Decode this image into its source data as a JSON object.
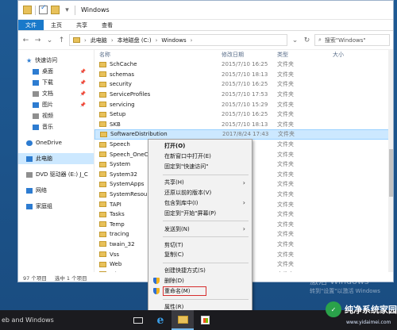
{
  "window": {
    "title": "Windows",
    "ribbon_tabs": [
      "文件",
      "主页",
      "共享",
      "查看"
    ],
    "breadcrumb": [
      "此电脑",
      "本地磁盘 (C:)",
      "Windows"
    ],
    "search_placeholder": "搜索\"Windows\""
  },
  "columns": {
    "name": "名称",
    "date": "修改日期",
    "type": "类型",
    "size": "大小"
  },
  "files": [
    {
      "name": "SchCache",
      "date": "2015/7/10 16:25",
      "type": "文件夹"
    },
    {
      "name": "schemas",
      "date": "2015/7/10 18:13",
      "type": "文件夹"
    },
    {
      "name": "security",
      "date": "2015/7/10 16:25",
      "type": "文件夹"
    },
    {
      "name": "ServiceProfiles",
      "date": "2015/7/10 17:53",
      "type": "文件夹"
    },
    {
      "name": "servicing",
      "date": "2015/7/10 15:29",
      "type": "文件夹"
    },
    {
      "name": "Setup",
      "date": "2015/7/10 16:25",
      "type": "文件夹"
    },
    {
      "name": "SKB",
      "date": "2015/7/10 18:13",
      "type": "文件夹"
    },
    {
      "name": "SoftwareDistribution",
      "date": "2017/8/24 17:43",
      "type": "文件夹"
    },
    {
      "name": "Speech",
      "date": "",
      "type": "文件夹"
    },
    {
      "name": "Speech_OneCo",
      "date": "",
      "type": "文件夹"
    },
    {
      "name": "System",
      "date": "",
      "type": "文件夹"
    },
    {
      "name": "System32",
      "date": "",
      "type": "文件夹"
    },
    {
      "name": "SystemApps",
      "date": "",
      "type": "文件夹"
    },
    {
      "name": "SystemResour",
      "date": "",
      "type": "文件夹"
    },
    {
      "name": "TAPI",
      "date": "",
      "type": "文件夹"
    },
    {
      "name": "Tasks",
      "date": "",
      "type": "文件夹"
    },
    {
      "name": "Temp",
      "date": "",
      "type": "文件夹"
    },
    {
      "name": "tracing",
      "date": "",
      "type": "文件夹"
    },
    {
      "name": "twain_32",
      "date": "",
      "type": "文件夹"
    },
    {
      "name": "Vss",
      "date": "",
      "type": "文件夹"
    },
    {
      "name": "Web",
      "date": "",
      "type": "文件夹"
    },
    {
      "name": "WinSxS",
      "date": "",
      "type": "文件夹"
    }
  ],
  "nav": {
    "quick_access": "快速访问",
    "quick_items": [
      "桌面",
      "下载",
      "文档",
      "图片",
      "视频",
      "音乐"
    ],
    "onedrive": "OneDrive",
    "this_pc": "此电脑",
    "dvd": "DVD 驱动器 (E:) J_C",
    "network": "网络",
    "homegroup": "家庭组"
  },
  "status": {
    "count": "97 个项目",
    "selected": "选中 1 个项目"
  },
  "context_menu": {
    "open": "打开(O)",
    "open_new_window": "在新窗口中打开(E)",
    "pin_quick": "固定到\"快速访问\"",
    "share": "共享(H)",
    "restore": "还原以前的版本(V)",
    "include_library": "包含到库中(I)",
    "pin_start": "固定到\"开始\"屏幕(P)",
    "send_to": "发送到(N)",
    "cut": "剪切(T)",
    "copy": "复制(C)",
    "create_shortcut": "创建快捷方式(S)",
    "delete": "删除(D)",
    "rename": "重命名(M)",
    "properties": "属性(R)"
  },
  "taskbar": {
    "text": "eb and Windows"
  },
  "watermark": {
    "activate": "激活 Windows",
    "activate_sub": "转到\"设置\"以激活 Windows",
    "brand": "纯净系统家园",
    "url": "www.yidaimei.com"
  }
}
